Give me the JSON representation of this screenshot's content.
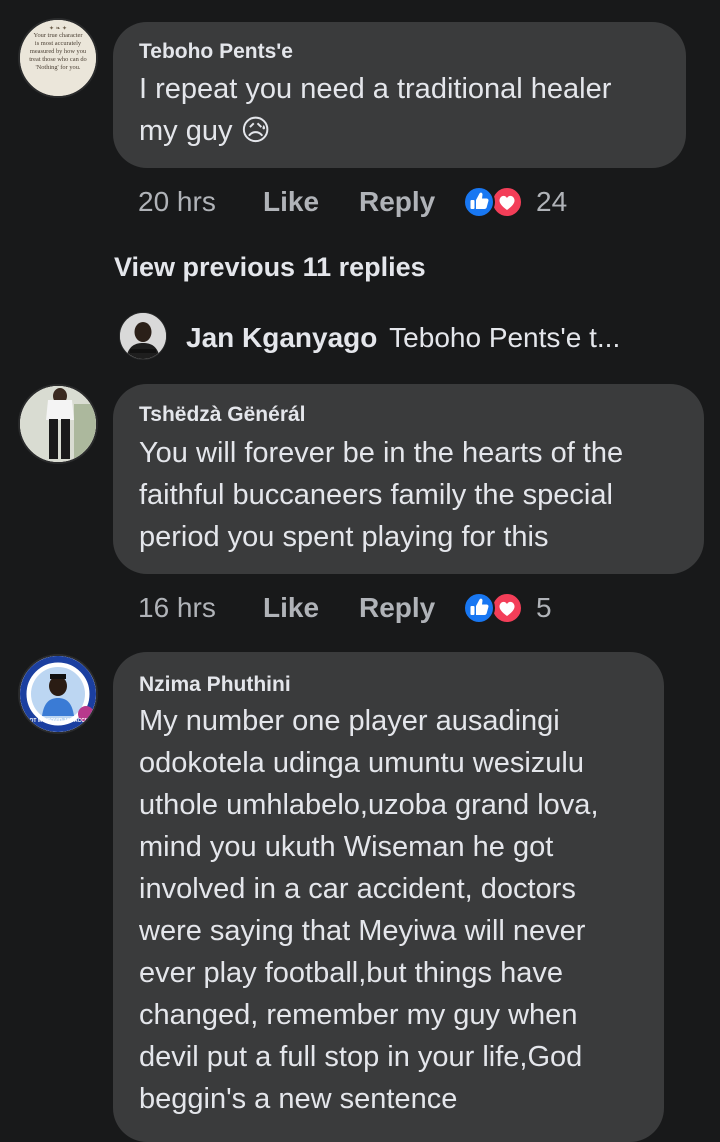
{
  "comments": [
    {
      "author": "Teboho Pents'e",
      "avatar_quote": [
        "Your true character",
        "is most accurately",
        "measured by how you",
        "treat those who can do",
        "'Nothing' for you."
      ],
      "lines": [
        "I repeat you need a traditional healer",
        "my guy 😥"
      ],
      "time": "20 hrs",
      "like_label": "Like",
      "reply_label": "Reply",
      "reaction_count": "24"
    },
    {
      "author": "Tshëdzà Gënérál",
      "lines": [
        "You will forever be in the hearts of the",
        "faithful buccaneers family  the special",
        "period you spent playing for this"
      ],
      "time": "16 hrs",
      "like_label": "Like",
      "reply_label": "Reply",
      "reaction_count": "5"
    },
    {
      "author": "Nzima Phuthini",
      "avatar_badge": "I GOT MY COVID-19 VACCINE",
      "lines": [
        "My number one player ausadingi",
        "odokotela udinga umuntu wesizulu",
        "uthole umhlabelo,uzoba grand lova,",
        "mind you ukuth Wiseman he got",
        "involved in a car accident, doctors",
        "were saying that Meyiwa will never",
        "ever play football,but things have",
        "changed, remember my guy when",
        "devil put a full stop in your life,God",
        "beggin's a new sentence"
      ]
    }
  ],
  "view_previous": "View previous 11 replies",
  "reply_preview": {
    "author": "Jan Kganyago",
    "snippet": "Teboho Pents'e t..."
  },
  "icons": {
    "like_reaction": "like-icon",
    "love_reaction": "love-icon"
  },
  "colors": {
    "background": "#18191a",
    "bubble": "#3a3b3c",
    "like_blue": "#1877f2",
    "love_red": "#f33e58",
    "secondary_text": "#b0b3b8"
  }
}
